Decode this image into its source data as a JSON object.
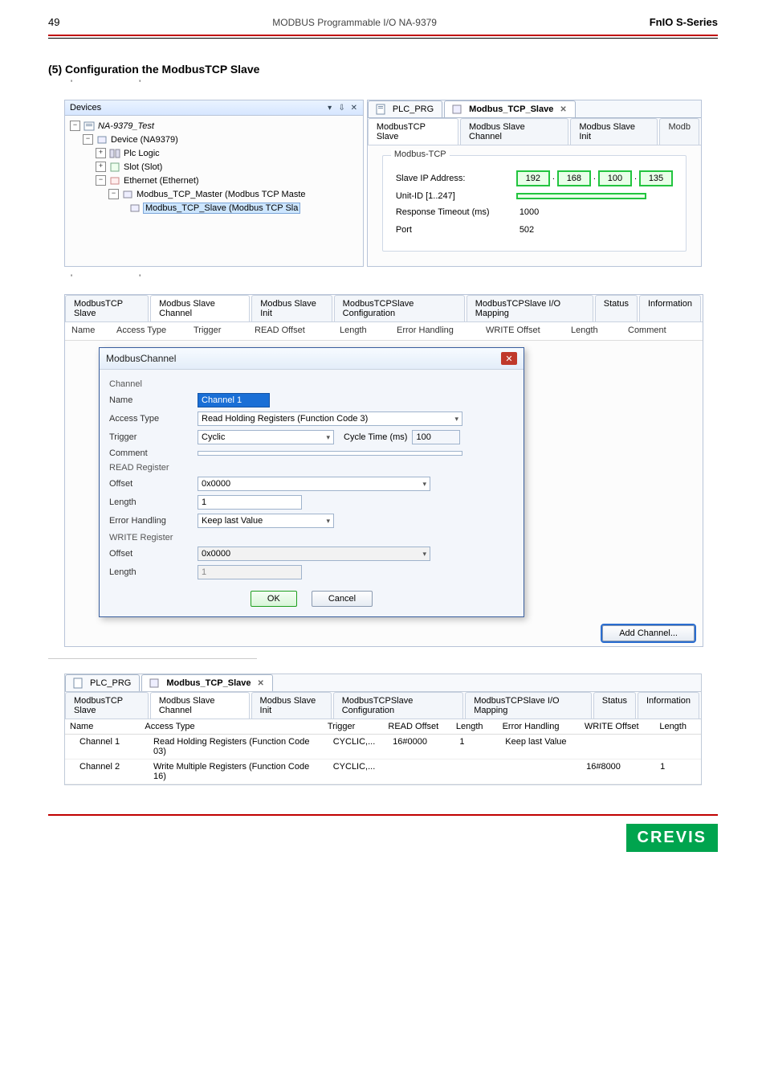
{
  "page": {
    "number": "49",
    "doc_title": "MODBUS Programmable I/O NA-9379",
    "series": "FnIO  S-Series"
  },
  "section_title": "(5) Configuration the ModbusTCP Slave",
  "devices_panel": {
    "title": "Devices",
    "tree": {
      "root": "NA-9379_Test",
      "device": "Device (NA9379)",
      "plc": "Plc Logic",
      "slot": "Slot (Slot)",
      "ethernet": "Ethernet (Ethernet)",
      "master": "Modbus_TCP_Master (Modbus TCP Maste",
      "slave": "Modbus_TCP_Slave (Modbus TCP Sla"
    }
  },
  "doc_tabs": {
    "plc_prg": "PLC_PRG",
    "slave": "Modbus_TCP_Slave"
  },
  "slave_config_tabs": {
    "t1": "ModbusTCP Slave",
    "t2": "Modbus Slave Channel",
    "t3": "Modbus Slave Init",
    "t4_trunc": "Modb"
  },
  "modbus_tcp_group": {
    "title": "Modbus-TCP",
    "ip_label": "Slave IP Address:",
    "ip": [
      "192",
      "168",
      "100",
      "135"
    ],
    "unit_label": "Unit-ID [1..247]",
    "unit_value": "",
    "timeout_label": "Response Timeout (ms)",
    "timeout_value": "1000",
    "port_label": "Port",
    "port_value": "502"
  },
  "channel_tabs": {
    "t1": "ModbusTCP Slave",
    "t2": "Modbus Slave Channel",
    "t3": "Modbus Slave Init",
    "t4": "ModbusTCPSlave Configuration",
    "t5": "ModbusTCPSlave I/O Mapping",
    "t6": "Status",
    "t7": "Information"
  },
  "channel_headers": {
    "name": "Name",
    "access": "Access Type",
    "trigger": "Trigger",
    "read_offset": "READ Offset",
    "length": "Length",
    "error": "Error Handling",
    "write_offset": "WRITE Offset",
    "length2": "Length",
    "comment": "Comment"
  },
  "dialog": {
    "title": "ModbusChannel",
    "group_channel": "Channel",
    "name_label": "Name",
    "name_value": "Channel 1",
    "access_label": "Access Type",
    "access_value": "Read Holding Registers (Function Code 3)",
    "trigger_label": "Trigger",
    "trigger_value": "Cyclic",
    "cycle_label": "Cycle Time (ms)",
    "cycle_value": "100",
    "comment_label": "Comment",
    "comment_value": "",
    "group_read": "READ Register",
    "offset_label": "Offset",
    "read_offset_value": "0x0000",
    "length_label": "Length",
    "read_length_value": "1",
    "error_label": "Error Handling",
    "error_value": "Keep last Value",
    "group_write": "WRITE Register",
    "write_offset_value": "0x0000",
    "write_length_value": "1",
    "ok": "OK",
    "cancel": "Cancel"
  },
  "add_channel_btn": "Add Channel...",
  "bottom_table": {
    "headers": {
      "name": "Name",
      "access": "Access Type",
      "trigger": "Trigger",
      "read_offset": "READ Offset",
      "length": "Length",
      "error": "Error Handling",
      "write_offset": "WRITE Offset",
      "length2": "Length"
    },
    "rows": [
      {
        "name": "Channel 1",
        "access": "Read Holding Registers (Function Code 03)",
        "trigger": "CYCLIC,...",
        "ro": "16#0000",
        "len": "1",
        "eh": "Keep last Value",
        "wo": "",
        "len2": ""
      },
      {
        "name": "Channel 2",
        "access": "Write Multiple Registers (Function Code 16)",
        "trigger": "CYCLIC,...",
        "ro": "",
        "len": "",
        "eh": "",
        "wo": "16#8000",
        "len2": "1"
      }
    ]
  },
  "footer_brand": "CREVIS"
}
